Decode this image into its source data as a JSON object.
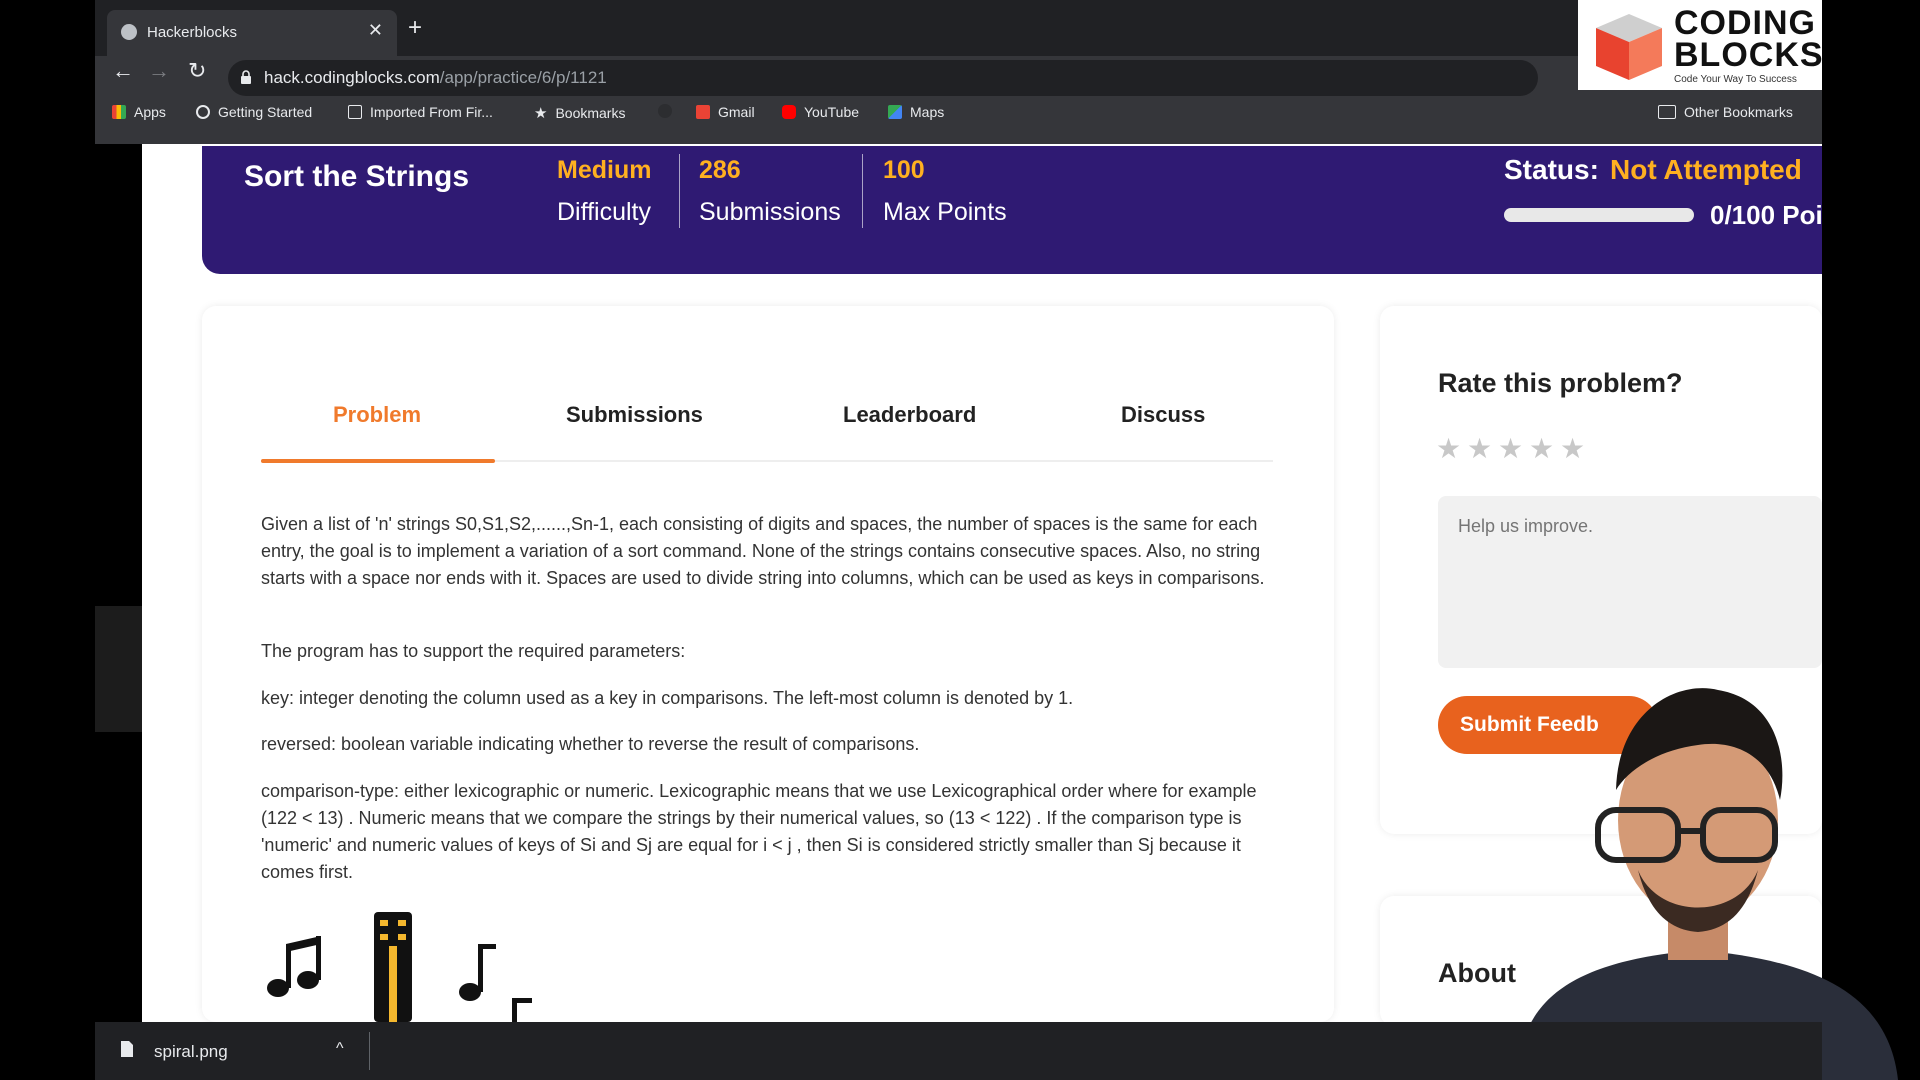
{
  "browser": {
    "tab_title": "Hackerblocks",
    "new_tab_symbol": "+",
    "url_host": "hack.codingblocks.com",
    "url_path": "/app/practice/6/p/1121",
    "bookmarks": [
      {
        "label": "Apps",
        "icon": "apps-grid-icon"
      },
      {
        "label": "Getting Started",
        "icon": "chrome-icon"
      },
      {
        "label": "Imported From Fir...",
        "icon": "folder-icon"
      },
      {
        "label": "Bookmarks",
        "icon": "star-icon"
      },
      {
        "label": "Gmail",
        "icon": "gmail-icon"
      },
      {
        "label": "YouTube",
        "icon": "youtube-icon"
      },
      {
        "label": "Maps",
        "icon": "maps-icon"
      }
    ],
    "other_bookmarks": "Other Bookmarks"
  },
  "logo": {
    "line1": "CODING",
    "line2": "BLOCKS",
    "tagline": "Code Your Way To Success"
  },
  "problem": {
    "title": "Sort the Strings",
    "difficulty_value": "Medium",
    "difficulty_label": "Difficulty",
    "submissions_value": "286",
    "submissions_label": "Submissions",
    "max_points_value": "100",
    "max_points_label": "Max Points",
    "status_label": "Status:",
    "status_value": "Not Attempted",
    "points": "0/100 Poi",
    "progress_fraction": 0
  },
  "tabs": [
    {
      "label": "Problem",
      "active": true
    },
    {
      "label": "Submissions",
      "active": false
    },
    {
      "label": "Leaderboard",
      "active": false
    },
    {
      "label": "Discuss",
      "active": false
    }
  ],
  "description": {
    "p1": "Given a list of 'n' strings S0,S1,S2,......,Sn-1, each consisting of digits and spaces, the number of spaces is the same for each entry, the goal is to implement a variation of a sort command. None of the strings contains consecutive spaces. Also, no string starts with a space nor ends with it. Spaces are used to divide string into columns, which can be used as keys in comparisons.",
    "p2": "The program has to support the required parameters:",
    "p3": "key: integer denoting the column used as a key in comparisons. The left-most column is denoted by 1.",
    "p4": "reversed: boolean variable indicating whether to reverse the result of comparisons.",
    "p5": "comparison-type: either lexicographic or numeric. Lexicographic means that we use Lexicographical order where for example (122 < 13) . Numeric means that we compare the strings by their numerical values, so (13 < 122) . If the comparison type is 'numeric' and numeric values of keys of Si and Sj are equal for i < j , then Si is considered strictly smaller than Sj because it comes first."
  },
  "sidebar": {
    "rate_title": "Rate this problem?",
    "stars": 5,
    "feedback_placeholder": "Help us improve.",
    "submit_label": "Submit Feedb",
    "about_label": "About"
  },
  "download": {
    "filename": "spiral.png",
    "chevron": "^"
  },
  "colors": {
    "banner": "#2f1a73",
    "accent": "#f07a2c",
    "highlight": "#ffb020",
    "button": "#e8621e"
  }
}
